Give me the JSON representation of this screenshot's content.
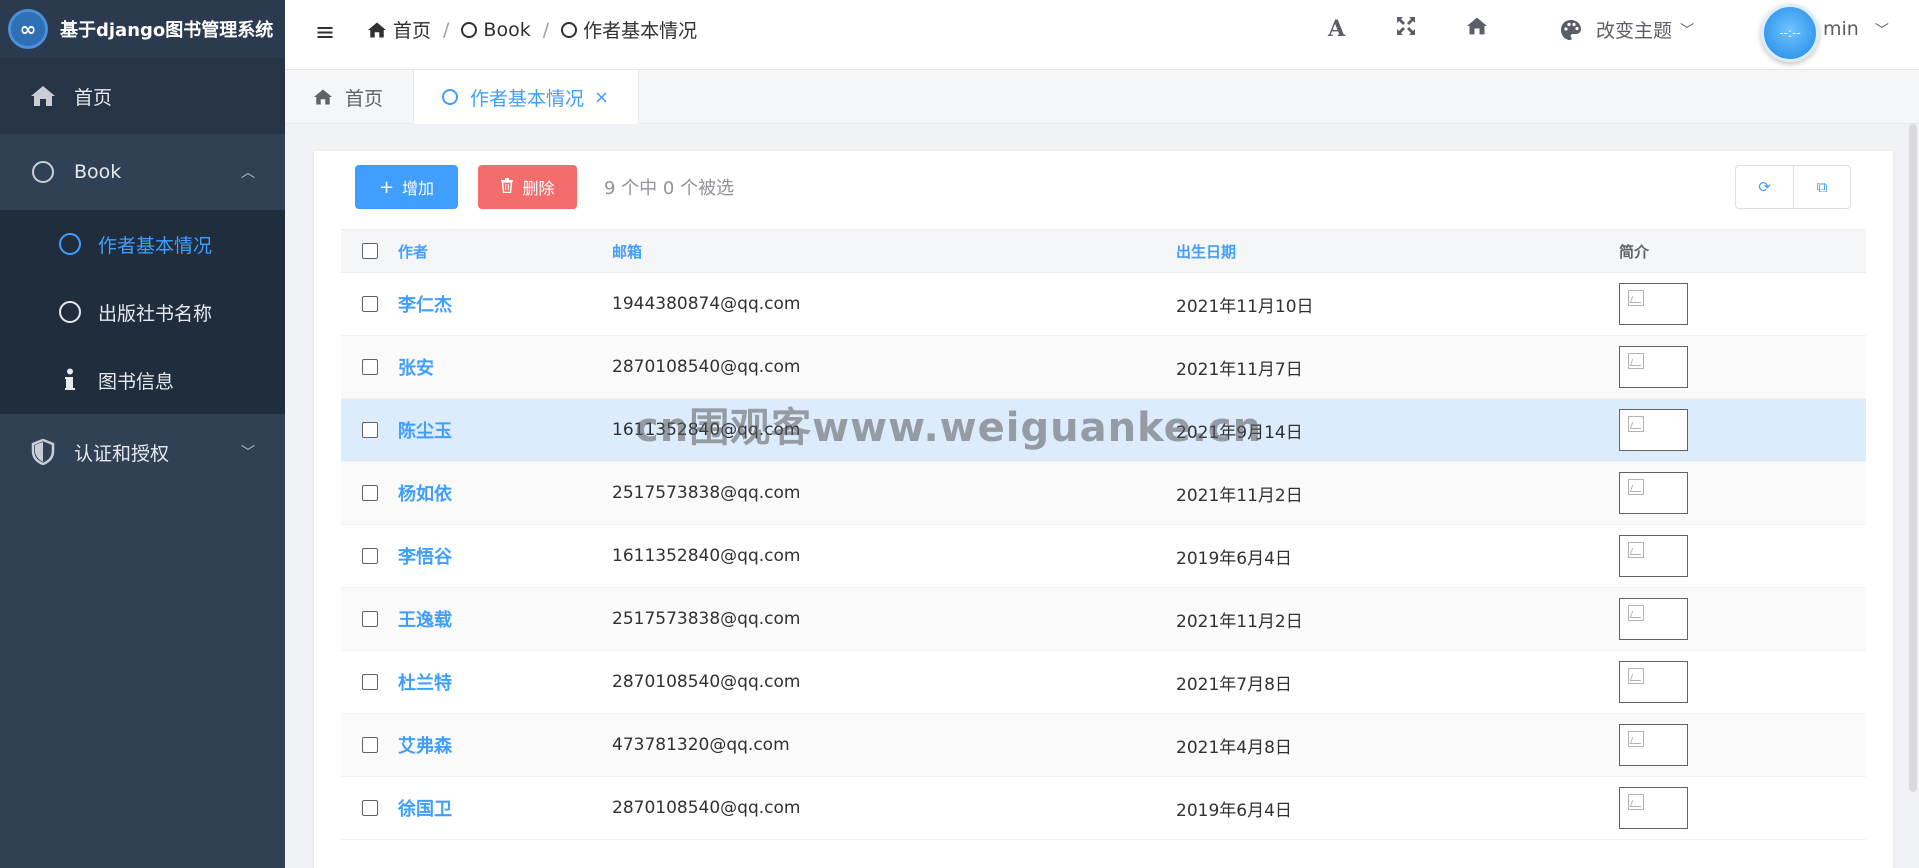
{
  "app": {
    "title": "基于django图书管理系统",
    "logo_glyph": "∞"
  },
  "sidebar": {
    "home": {
      "label": "首页",
      "icon": "home-icon"
    },
    "book": {
      "label": "Book",
      "icon": "circle-icon",
      "chevron": "︿"
    },
    "book_items": [
      {
        "label": "作者基本情况",
        "icon": "circle-icon",
        "active": true
      },
      {
        "label": "出版社书名称",
        "icon": "circle-icon",
        "active": false
      },
      {
        "label": "图书信息",
        "icon": "info-icon",
        "active": false
      }
    ],
    "auth": {
      "label": "认证和授权",
      "icon": "shield-icon",
      "chevron": "﹀"
    }
  },
  "header": {
    "menu_icon": "≡",
    "breadcrumb": [
      {
        "label": "首页",
        "icon": "home-icon"
      },
      {
        "label": "Book",
        "icon": "circle-icon"
      },
      {
        "label": "作者基本情况",
        "icon": "circle-icon"
      }
    ],
    "separator": "/",
    "font_btn": "A",
    "fullscreen_btn": "⤡",
    "home_btn": "⌂",
    "theme_label": "改变主题",
    "theme_chevron": "﹀",
    "avatar_text": "--:--",
    "user_name": "min",
    "user_chevron": "﹀"
  },
  "tabs": [
    {
      "label": "首页",
      "icon": "home-icon",
      "active": false
    },
    {
      "label": "作者基本情况",
      "icon": "circle-icon",
      "active": true,
      "close": "×"
    }
  ],
  "toolbar": {
    "add_label": "增加",
    "add_icon": "+",
    "delete_label": "删除",
    "delete_icon": "🗑",
    "selection_info": "9 个中 0 个被选",
    "refresh_icon": "⟳",
    "export_icon": "⧉"
  },
  "table": {
    "columns": [
      "作者",
      "邮箱",
      "出生日期",
      "简介"
    ],
    "rows": [
      {
        "author": "李仁杰",
        "email": "1944380874@qq.com",
        "birth": "2021年11月10日"
      },
      {
        "author": "张安",
        "email": "2870108540@qq.com",
        "birth": "2021年11月7日"
      },
      {
        "author": "陈尘玉",
        "email": "1611352840@qq.com",
        "birth": "2021年9月14日"
      },
      {
        "author": "杨如依",
        "email": "2517573838@qq.com",
        "birth": "2021年11月2日"
      },
      {
        "author": "李悟谷",
        "email": "1611352840@qq.com",
        "birth": "2019年6月4日"
      },
      {
        "author": "王逸载",
        "email": "2517573838@qq.com",
        "birth": "2021年11月2日"
      },
      {
        "author": "杜兰特",
        "email": "2870108540@qq.com",
        "birth": "2021年7月8日"
      },
      {
        "author": "艾弗森",
        "email": "473781320@qq.com",
        "birth": "2021年4月8日"
      },
      {
        "author": "徐国卫",
        "email": "2870108540@qq.com",
        "birth": "2019年6月4日"
      }
    ]
  },
  "watermark": "cn围观客www.weiguanke.cn",
  "colors": {
    "sidebar_bg": "#304156",
    "accent": "#409eff",
    "danger": "#f56c6c",
    "highlight_row": "#dcecfc"
  }
}
